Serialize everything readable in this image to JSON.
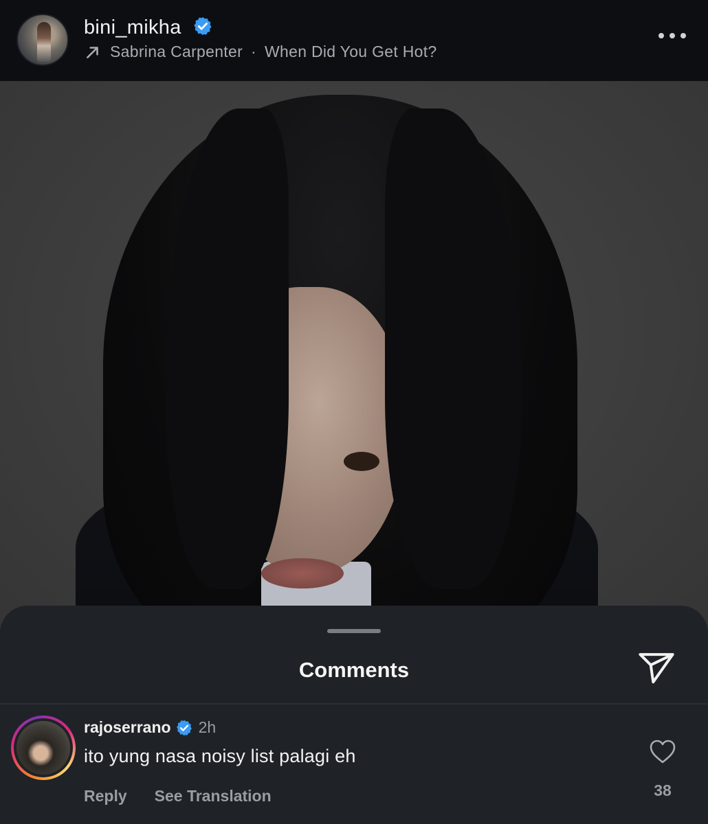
{
  "header": {
    "username": "bini_mikha",
    "music": {
      "artist": "Sabrina Carpenter",
      "separator": "·",
      "song": "When Did You Get Hot?"
    },
    "more_icon": "more-horizontal-icon"
  },
  "sheet": {
    "title": "Comments",
    "share_icon": "send-icon"
  },
  "comment": {
    "username": "rajoserrano",
    "time": "2h",
    "text": "ito yung nasa noisy list palagi eh",
    "reply_label": "Reply",
    "translation_label": "See Translation",
    "like_count": "38"
  },
  "colors": {
    "verified": "#3b9bf5",
    "sheet_bg": "#1f2226",
    "header_bg": "#0d0e12"
  }
}
